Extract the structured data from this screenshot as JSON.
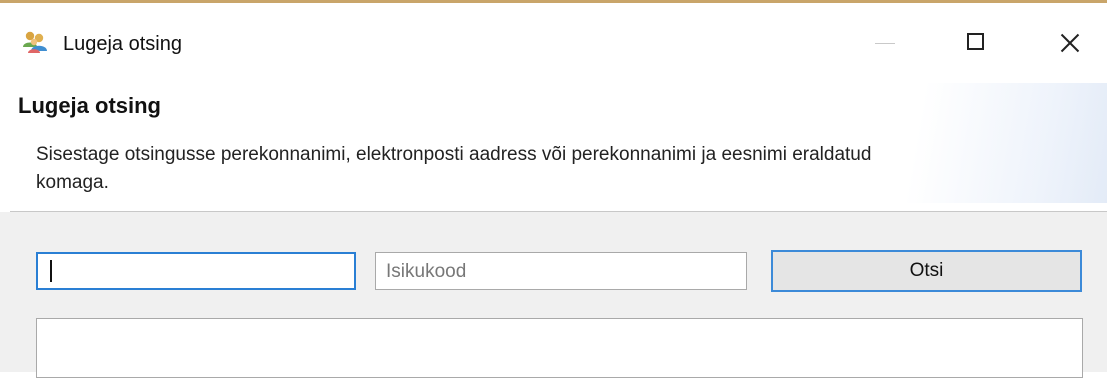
{
  "window": {
    "title": "Lugeja otsing",
    "icon": "users-icon"
  },
  "dialog": {
    "heading": "Lugeja otsing",
    "description": "Sisestage otsingusse perekonnanimi, elektronposti aadress või perekonnanimi ja eesnimi eraldatud komaga."
  },
  "form": {
    "name_input_value": "",
    "id_input_placeholder": "Isikukood",
    "search_button_label": "Otsi"
  },
  "colors": {
    "focus_accent": "#2a7fd4",
    "title_border": "#c9a56a"
  }
}
